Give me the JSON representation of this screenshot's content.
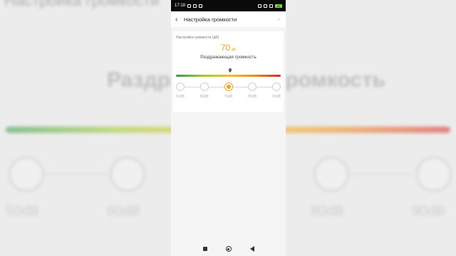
{
  "status_bar": {
    "time": "17:18",
    "battery": "80"
  },
  "header": {
    "back_icon": "chevron-left-icon",
    "title": "Настройка громкости",
    "confirm_icon": "check-icon"
  },
  "volume": {
    "section_label": "Настройка громкости (дБ)",
    "value": "70",
    "unit": "дБ",
    "description": "Раздражающая громкость",
    "selected_index": 2,
    "steps": [
      "50dB",
      "60dB",
      "70dB",
      "80dB",
      "90dB"
    ],
    "colors": {
      "accent": "#f2a219",
      "gradient": [
        "#2f9c4a",
        "#9ecb2a",
        "#f2c21a",
        "#f28a1a",
        "#d82a2a"
      ]
    }
  },
  "background": {
    "top_text": "Настройка громкости",
    "big_text": "Раздражающая громкость",
    "ticks": [
      "50dB",
      "60dB",
      "80dB",
      "90dB"
    ]
  },
  "nav_bar": {
    "recent_icon": "square-icon",
    "home_icon": "circle-icon",
    "back_icon": "triangle-back-icon"
  }
}
